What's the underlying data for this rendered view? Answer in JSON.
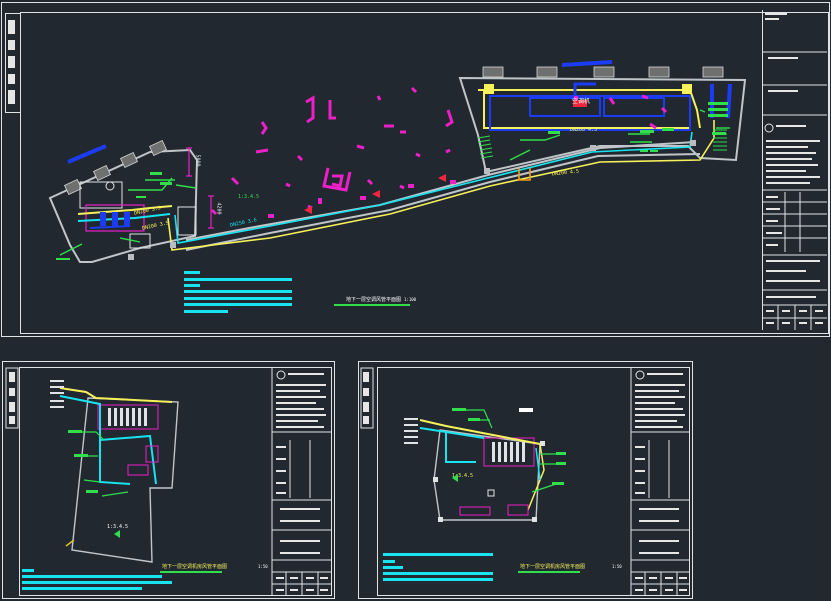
{
  "colors": {
    "background": "#212830",
    "frame": "#dfe3e6",
    "wall": "#bfc5c9",
    "cyan": "#19e3ef",
    "yellow": "#f6f05a",
    "magenta": "#ec1fc8",
    "green": "#2fe04a",
    "blue": "#1b3cf0",
    "red": "#f2263c",
    "orange": "#f59a1c"
  },
  "main_sheet": {
    "labels": {
      "room_left": "DN200 3.5",
      "room_left_2": "DN200 3.5",
      "main_duct": "DN250 3.6",
      "main_duct_right": "DN200 4.5",
      "upper_duct": "DN200 4.5",
      "hall_tag": "1:3.4.5",
      "red_tag": "空调机",
      "plan_title": "地下一层空调风管平面图",
      "plan_scale": "1:100"
    },
    "dims": {
      "dim_a": "5000",
      "dim_b": "4200"
    }
  },
  "sheet_left": {
    "labels": {
      "hall_tag": "1:3.4.5",
      "plan_title": "地下一层空调机房风管平面图",
      "plan_scale": "1:50"
    }
  },
  "sheet_right": {
    "labels": {
      "hall_tag": "1:3.4.5",
      "plan_title": "地下一层空调机房风管平面图",
      "plan_scale": "1:50"
    }
  }
}
